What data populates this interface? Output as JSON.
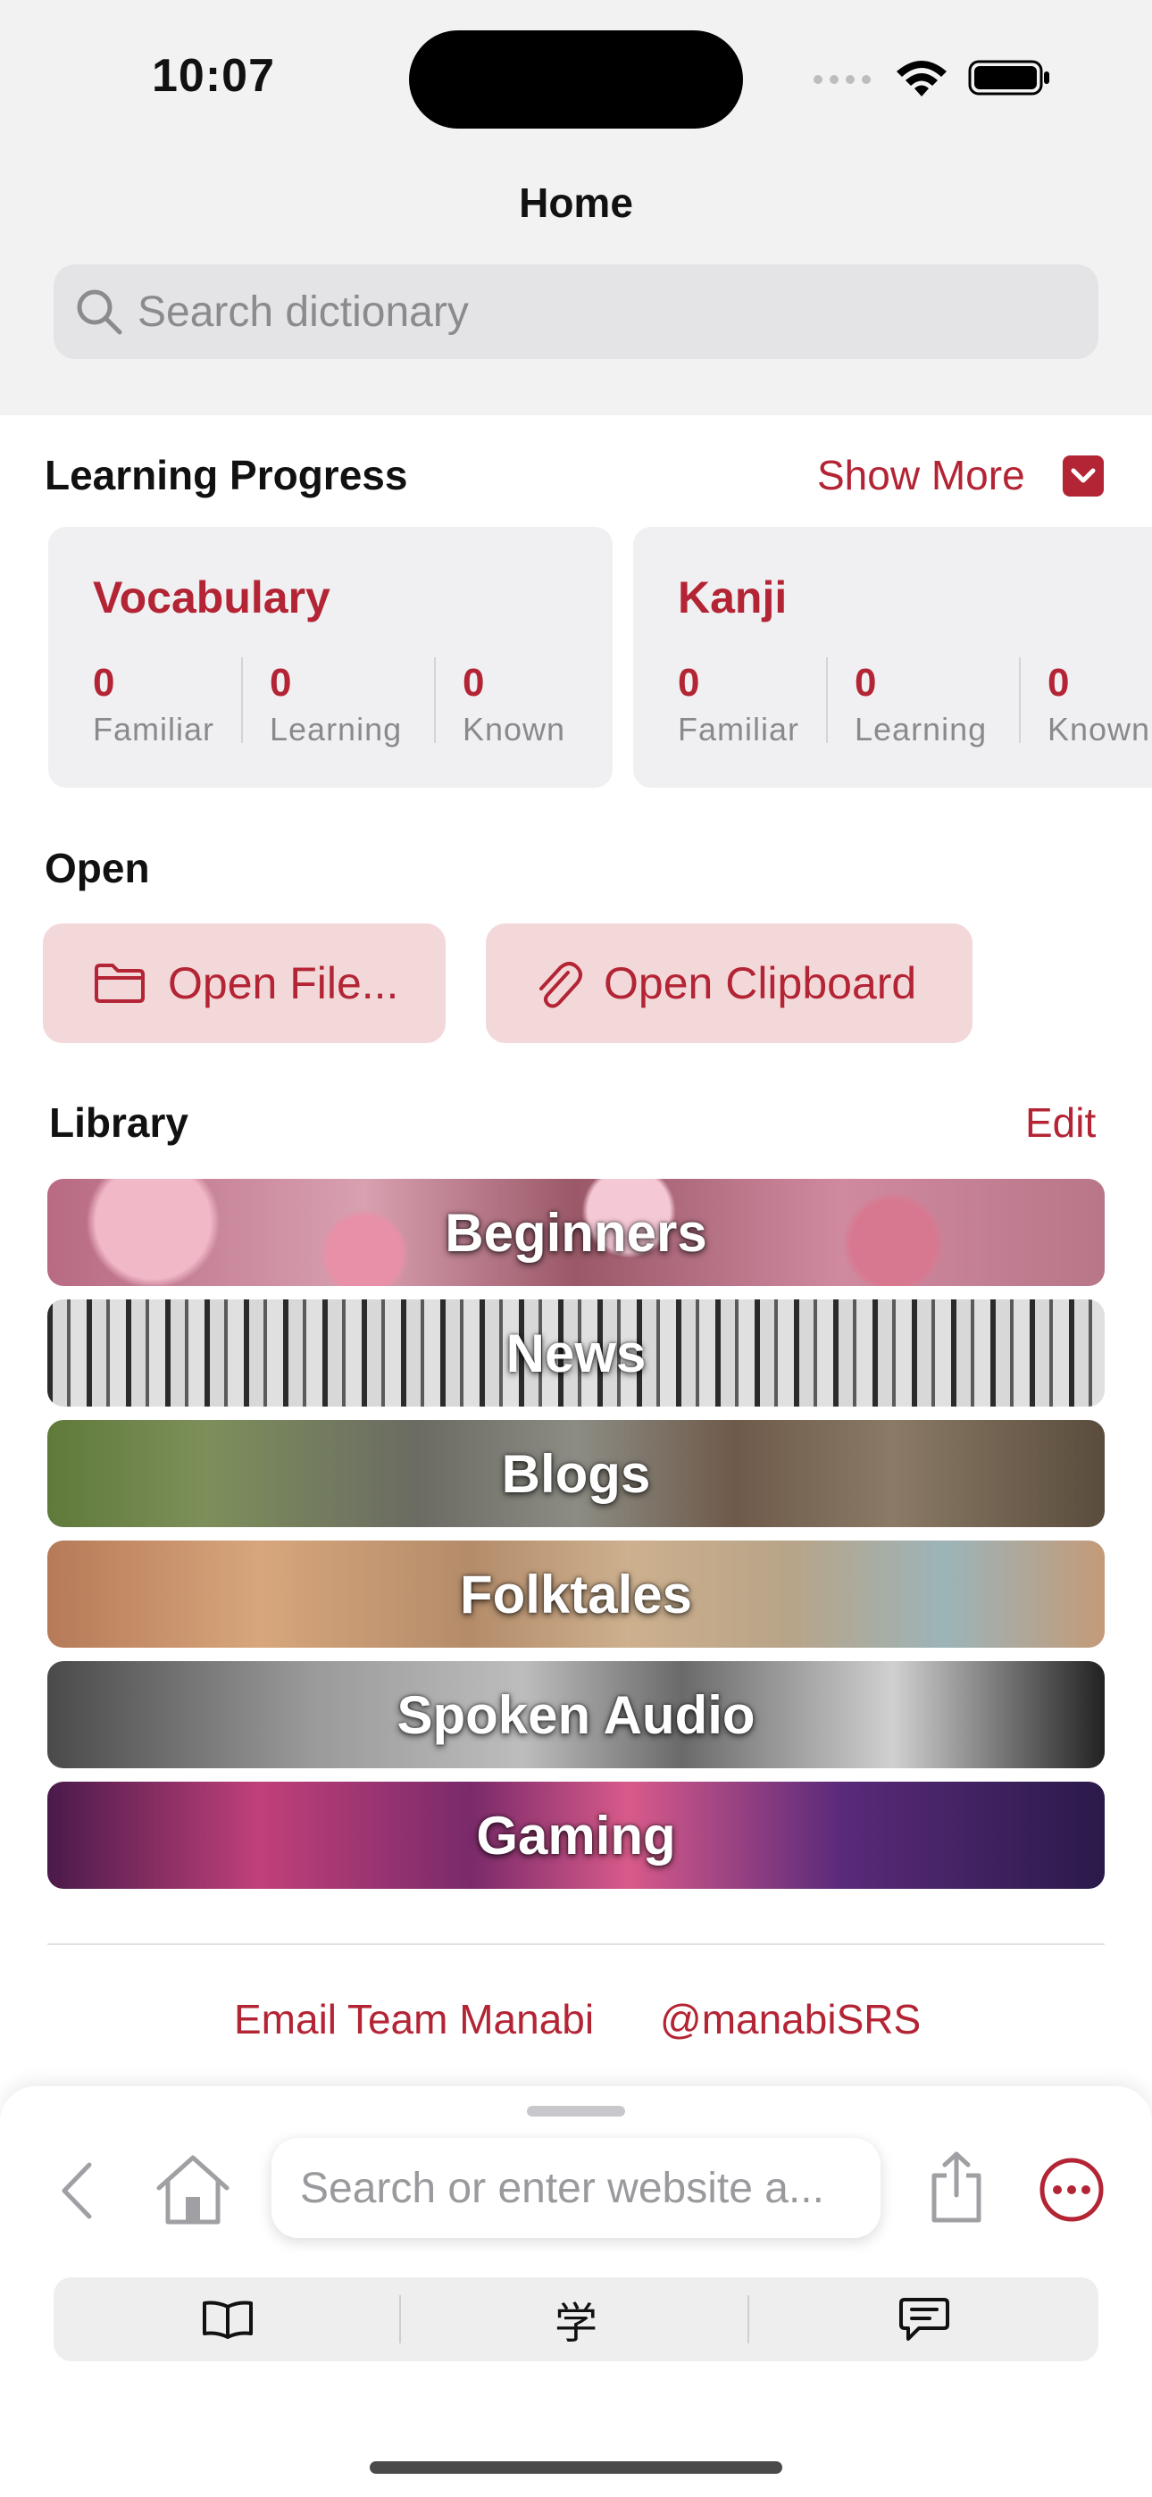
{
  "status_bar": {
    "time": "10:07"
  },
  "header": {
    "title": "Home",
    "search_placeholder": "Search dictionary"
  },
  "learning_progress": {
    "title": "Learning Progress",
    "show_more": "Show More",
    "cards": [
      {
        "title": "Vocabulary",
        "stats": [
          {
            "value": "0",
            "label": "Familiar"
          },
          {
            "value": "0",
            "label": "Learning"
          },
          {
            "value": "0",
            "label": "Known"
          }
        ]
      },
      {
        "title": "Kanji",
        "stats": [
          {
            "value": "0",
            "label": "Familiar"
          },
          {
            "value": "0",
            "label": "Learning"
          },
          {
            "value": "0",
            "label": "Known"
          }
        ]
      }
    ]
  },
  "open_section": {
    "title": "Open",
    "open_file": "Open File...",
    "open_clipboard": "Open Clipboard"
  },
  "library": {
    "title": "Library",
    "edit": "Edit",
    "items": [
      "Beginners",
      "News",
      "Blogs",
      "Folktales",
      "Spoken Audio",
      "Gaming"
    ]
  },
  "footer": {
    "email": "Email Team Manabi",
    "twitter": "@manabiSRS"
  },
  "browser": {
    "url_placeholder": "Search or enter website a...",
    "tab_kanji": "学"
  },
  "colors": {
    "accent": "#b32434",
    "button_bg": "#f3d8da"
  }
}
